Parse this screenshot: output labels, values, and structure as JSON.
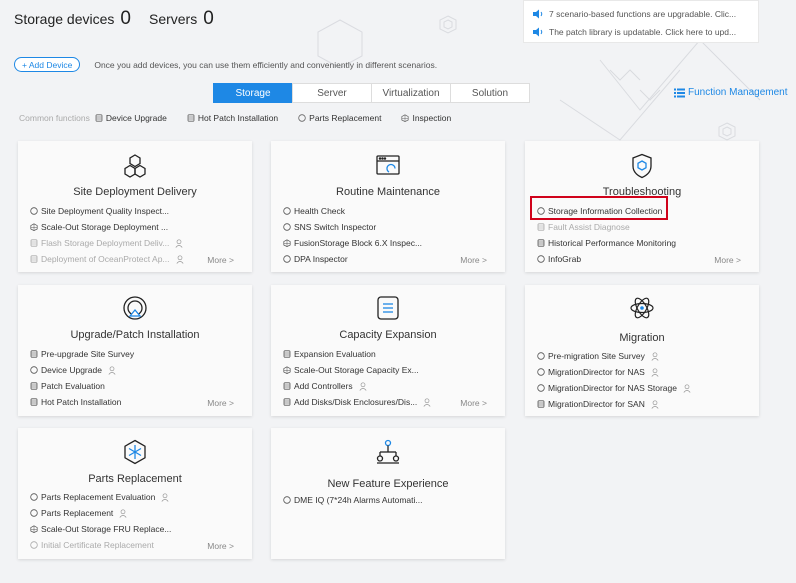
{
  "header": {
    "storage_label": "Storage devices",
    "storage_count": "0",
    "servers_label": "Servers",
    "servers_count": "0"
  },
  "notices": [
    {
      "text": "7 scenario-based functions are upgradable. Clic..."
    },
    {
      "text": "The patch library is updatable. Click here to upd..."
    }
  ],
  "add_device": {
    "label": "+ Add Device",
    "hint": "Once you add devices, you can use them efficiently and conveniently in different scenarios."
  },
  "tabs": [
    "Storage",
    "Server",
    "Virtualization",
    "Solution"
  ],
  "active_tab": "Storage",
  "function_management": "Function Management",
  "common": {
    "label": "Common functions",
    "items": [
      {
        "icon": "db-icon",
        "label": "Device Upgrade"
      },
      {
        "icon": "db-icon",
        "label": "Hot Patch Installation"
      },
      {
        "icon": "circle-icon",
        "label": "Parts Replacement"
      },
      {
        "icon": "cluster-icon",
        "label": "Inspection"
      }
    ]
  },
  "cards": [
    {
      "title": "Site Deployment Delivery",
      "icon": "hexagons-icon",
      "items": [
        {
          "icon": "circle-icon",
          "label": "Site Deployment Quality Inspect...",
          "disabled": false,
          "person": false
        },
        {
          "icon": "cluster-icon",
          "label": "Scale-Out Storage Deployment ...",
          "disabled": false,
          "person": false
        },
        {
          "icon": "db-icon",
          "label": "Flash Storage Deployment Deliv...",
          "disabled": true,
          "person": true
        },
        {
          "icon": "db-icon",
          "label": "Deployment of OceanProtect Ap...",
          "disabled": true,
          "person": true
        }
      ],
      "more": "More >"
    },
    {
      "title": "Routine Maintenance",
      "icon": "monitor-icon",
      "items": [
        {
          "icon": "circle-icon",
          "label": "Health Check",
          "disabled": false,
          "person": false
        },
        {
          "icon": "circle-icon",
          "label": "SNS Switch Inspector",
          "disabled": false,
          "person": false
        },
        {
          "icon": "cluster-icon",
          "label": "FusionStorage Block 6.X Inspec...",
          "disabled": false,
          "person": false
        },
        {
          "icon": "circle-icon",
          "label": "DPA Inspector",
          "disabled": false,
          "person": false
        }
      ],
      "more": "More >"
    },
    {
      "title": "Troubleshooting",
      "icon": "shield-icon",
      "items": [
        {
          "icon": "circle-icon",
          "label": "Storage Information Collection",
          "disabled": false,
          "person": false
        },
        {
          "icon": "db-icon",
          "label": "Fault Assist Diagnose",
          "disabled": true,
          "person": false
        },
        {
          "icon": "db-icon",
          "label": "Historical Performance Monitoring",
          "disabled": false,
          "person": false
        },
        {
          "icon": "circle-icon",
          "label": "InfoGrab",
          "disabled": false,
          "person": false
        }
      ],
      "more": "More >"
    },
    {
      "title": "Upgrade/Patch Installation",
      "icon": "upgrade-icon",
      "items": [
        {
          "icon": "db-icon",
          "label": "Pre-upgrade Site Survey",
          "disabled": false,
          "person": false
        },
        {
          "icon": "circle-icon",
          "label": "Device Upgrade",
          "disabled": false,
          "person": true
        },
        {
          "icon": "db-icon",
          "label": "Patch Evaluation",
          "disabled": false,
          "person": false
        },
        {
          "icon": "db-icon",
          "label": "Hot Patch Installation",
          "disabled": false,
          "person": false
        }
      ],
      "more": "More >"
    },
    {
      "title": "Capacity Expansion",
      "icon": "stack-icon",
      "items": [
        {
          "icon": "db-icon",
          "label": "Expansion Evaluation",
          "disabled": false,
          "person": false
        },
        {
          "icon": "cluster-icon",
          "label": "Scale-Out Storage Capacity Ex...",
          "disabled": false,
          "person": false
        },
        {
          "icon": "db-icon",
          "label": "Add Controllers",
          "disabled": false,
          "person": true
        },
        {
          "icon": "db-icon",
          "label": "Add Disks/Disk Enclosures/Dis...",
          "disabled": false,
          "person": true
        }
      ],
      "more": "More >"
    },
    {
      "title": "Migration",
      "icon": "atom-icon",
      "items": [
        {
          "icon": "circle-icon",
          "label": "Pre-migration Site Survey",
          "disabled": false,
          "person": true
        },
        {
          "icon": "circle-icon",
          "label": "MigrationDirector for NAS",
          "disabled": false,
          "person": true
        },
        {
          "icon": "circle-icon",
          "label": "MigrationDirector for NAS Storage",
          "disabled": false,
          "person": true
        },
        {
          "icon": "db-icon",
          "label": "MigrationDirector for SAN",
          "disabled": false,
          "person": true
        }
      ],
      "more": ""
    },
    {
      "title": "Parts Replacement",
      "icon": "snowflake-icon",
      "items": [
        {
          "icon": "circle-icon",
          "label": "Parts Replacement Evaluation",
          "disabled": false,
          "person": true
        },
        {
          "icon": "circle-icon",
          "label": "Parts Replacement",
          "disabled": false,
          "person": true
        },
        {
          "icon": "cluster-icon",
          "label": "Scale-Out Storage FRU Replace...",
          "disabled": false,
          "person": false
        },
        {
          "icon": "circle-icon",
          "label": "Initial Certificate Replacement",
          "disabled": true,
          "person": false
        }
      ],
      "more": "More >"
    },
    {
      "title": "New Feature Experience",
      "icon": "network-icon",
      "items": [
        {
          "icon": "circle-icon",
          "label": "DME IQ (7*24h Alarms Automati...",
          "disabled": false,
          "person": false
        }
      ],
      "more": ""
    }
  ],
  "colors": {
    "accent": "#1e88e5",
    "highlight": "#d0021b"
  }
}
